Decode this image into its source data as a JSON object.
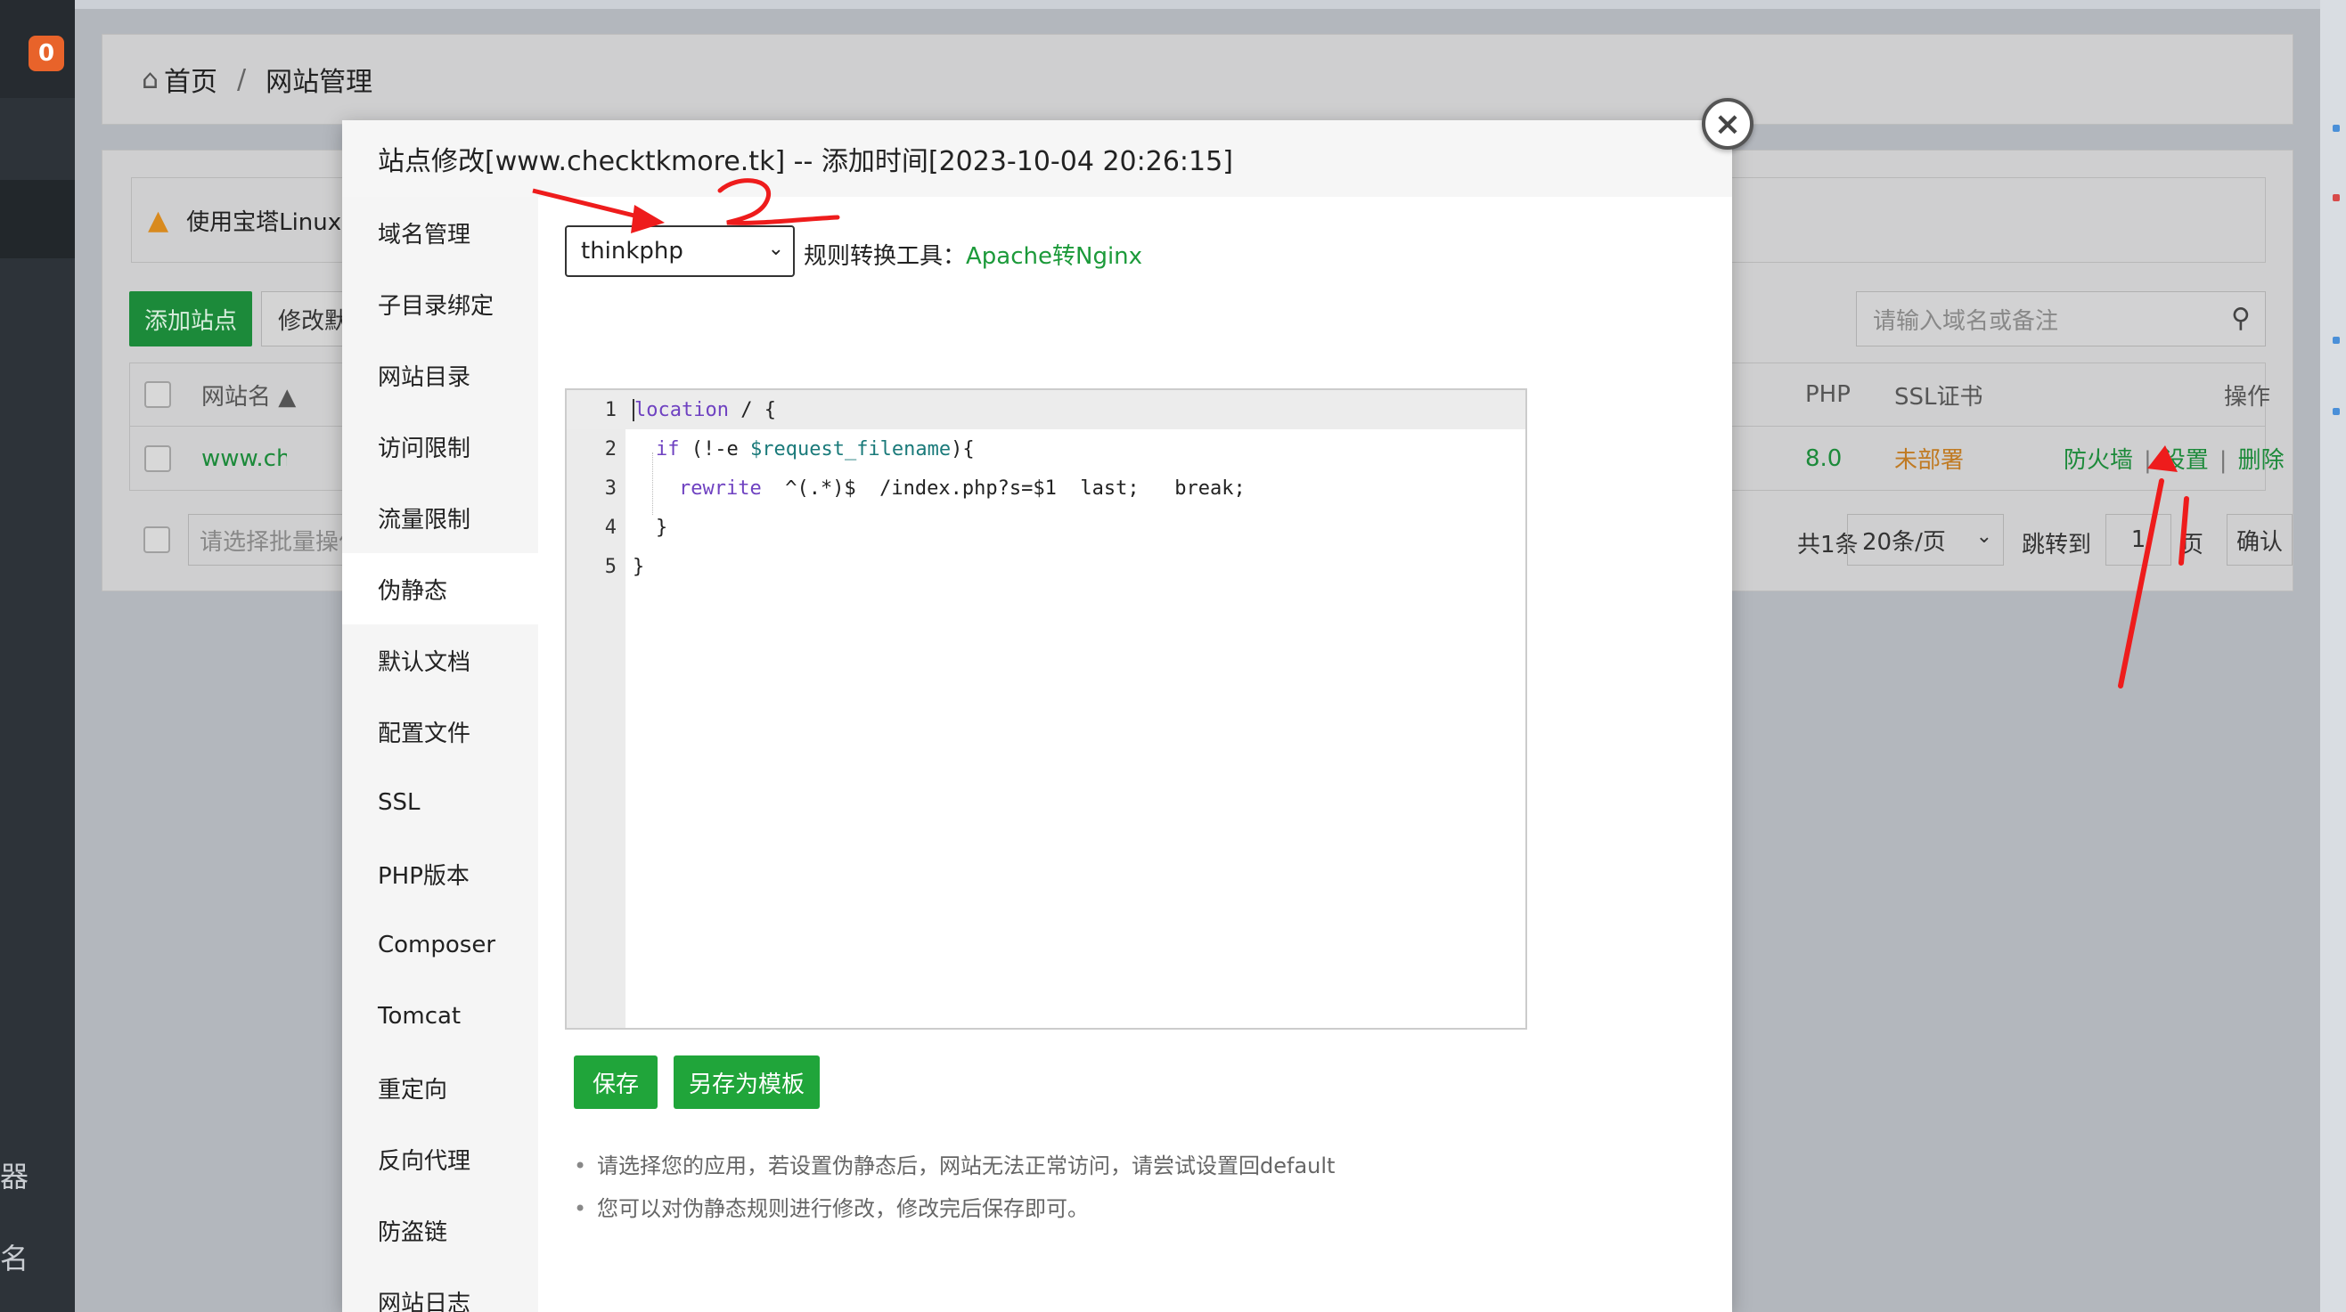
{
  "sidebar": {
    "badge_count": "0",
    "frag_1": "器",
    "frag_2": "名"
  },
  "breadcrumb": {
    "home": "首页",
    "separator": "/",
    "current": "网站管理"
  },
  "warning": {
    "text": "使用宝塔Linux面"
  },
  "toolbar": {
    "add_site": "添加站点",
    "modify_default": "修改默认页"
  },
  "search": {
    "placeholder": "请输入域名或备注"
  },
  "table": {
    "headers": {
      "site_name": "网站名",
      "php": "PHP",
      "ssl": "SSL证书",
      "ops": "操作"
    },
    "rows": [
      {
        "site_name": "www.checktkmore.tk",
        "php": "8.0",
        "ssl": "未部署",
        "ops": [
          "防火墙",
          "设置",
          "删除"
        ]
      }
    ]
  },
  "footer": {
    "batch_placeholder": "请选择批量操作",
    "total": "共1条",
    "page_size": "20条/页",
    "jump_label": "跳转到",
    "page_input": "1",
    "page_suffix": "页",
    "confirm": "确认"
  },
  "modal": {
    "title": "站点修改[www.checktkmore.tk] -- 添加时间[2023-10-04 20:26:15]",
    "close": "×",
    "nav": [
      "域名管理",
      "子目录绑定",
      "网站目录",
      "访问限制",
      "流量限制",
      "伪静态",
      "默认文档",
      "配置文件",
      "SSL",
      "PHP版本",
      "Composer",
      "Tomcat",
      "重定向",
      "反向代理",
      "防盗链",
      "网站日志"
    ],
    "active_nav": "伪静态",
    "app_select": "thinkphp",
    "tool_label": "规则转换工具：",
    "tool_link": "Apache转Nginx",
    "code_lines": [
      {
        "num": "1",
        "text": "location / {"
      },
      {
        "num": "2",
        "text": "if (!-e $request_filename){"
      },
      {
        "num": "3",
        "text": "rewrite  ^(.*)$  /index.php?s=$1  last;   break;"
      },
      {
        "num": "4",
        "text": "}"
      },
      {
        "num": "5",
        "text": "}"
      }
    ],
    "save": "保存",
    "save_template": "另存为模板",
    "tips": [
      "请选择您的应用，若设置伪静态后，网站无法正常访问，请尝试设置回default",
      "您可以对伪静态规则进行修改，修改完后保存即可。"
    ]
  },
  "colors": {
    "accent_green": "#20a53a",
    "annotation_red": "#ee1c1c",
    "badge_orange": "#e8632a"
  }
}
